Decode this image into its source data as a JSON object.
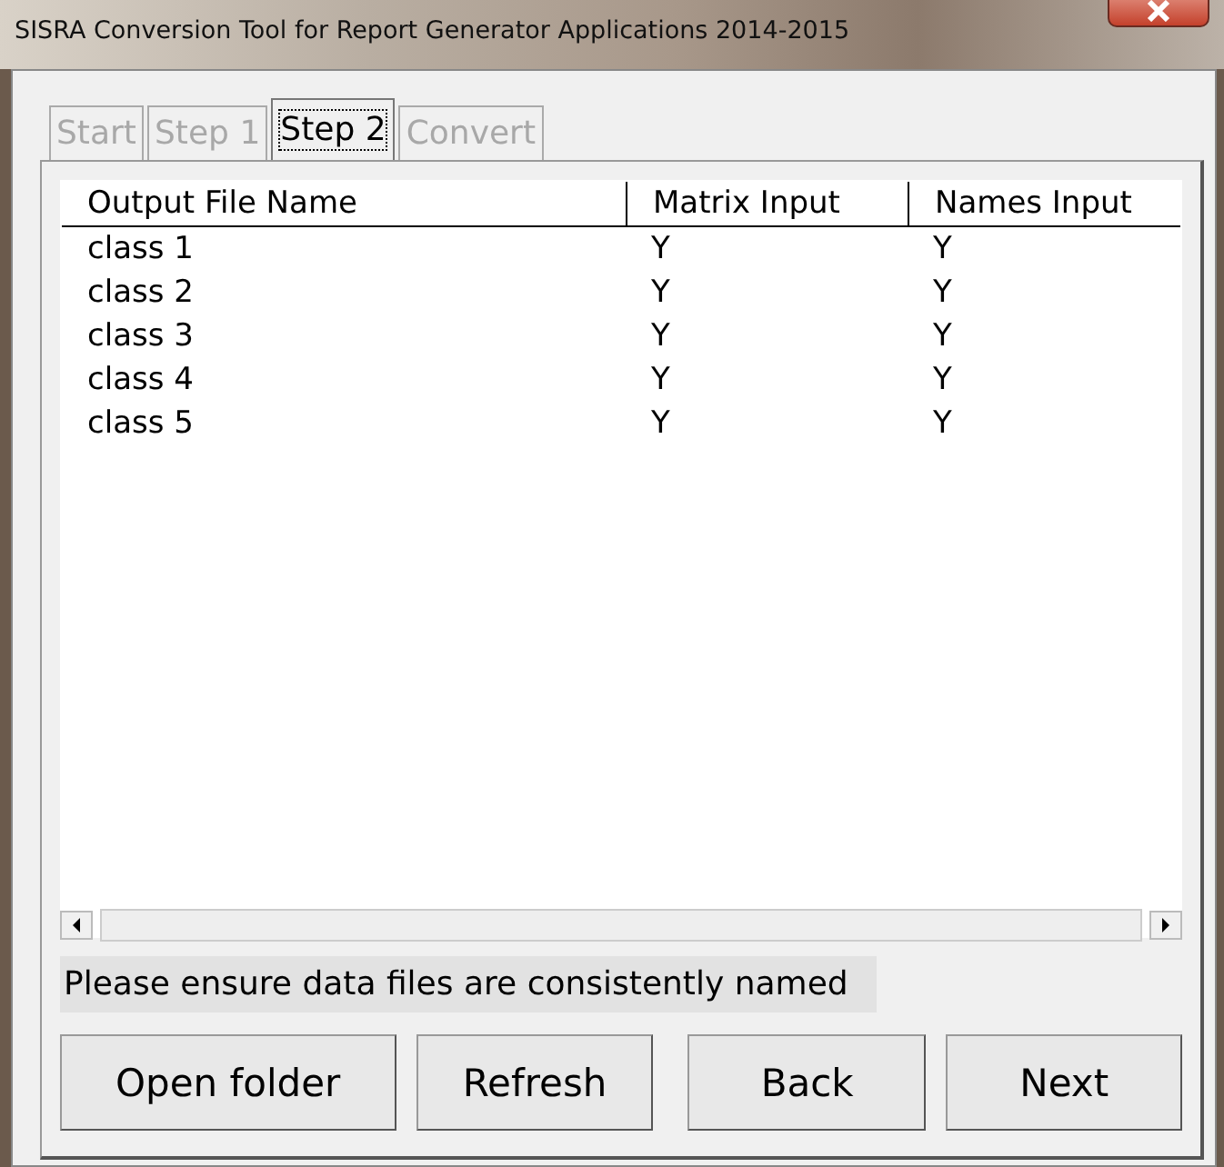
{
  "window": {
    "title": "SISRA Conversion Tool for Report Generator Applications 2014-2015"
  },
  "tabs": [
    {
      "label": "Start",
      "selected": false,
      "disabled": true
    },
    {
      "label": "Step 1",
      "selected": false,
      "disabled": true
    },
    {
      "label": "Step 2",
      "selected": true,
      "disabled": false
    },
    {
      "label": "Convert",
      "selected": false,
      "disabled": true
    }
  ],
  "table": {
    "columns": [
      "Output File Name",
      "Matrix Input",
      "Names Input"
    ],
    "rows": [
      [
        "class 1",
        "Y",
        "Y"
      ],
      [
        "class 2",
        "Y",
        "Y"
      ],
      [
        "class 3",
        "Y",
        "Y"
      ],
      [
        "class 4",
        "Y",
        "Y"
      ],
      [
        "class 5",
        "Y",
        "Y"
      ]
    ]
  },
  "message": "Please ensure data files are consistently named",
  "buttons": [
    "Open folder",
    "Refresh",
    "Back",
    "Next"
  ]
}
